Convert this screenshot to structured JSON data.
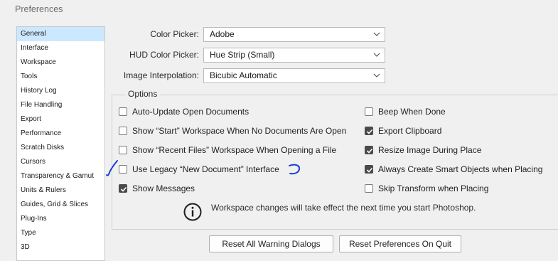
{
  "window": {
    "title": "Preferences"
  },
  "sidebar": {
    "items": [
      {
        "label": "General",
        "selected": true
      },
      {
        "label": "Interface"
      },
      {
        "label": "Workspace"
      },
      {
        "label": "Tools"
      },
      {
        "label": "History Log"
      },
      {
        "label": "File Handling"
      },
      {
        "label": "Export"
      },
      {
        "label": "Performance"
      },
      {
        "label": "Scratch Disks"
      },
      {
        "label": "Cursors"
      },
      {
        "label": "Transparency & Gamut"
      },
      {
        "label": "Units & Rulers"
      },
      {
        "label": "Guides, Grid & Slices"
      },
      {
        "label": "Plug-Ins"
      },
      {
        "label": "Type"
      },
      {
        "label": "3D"
      }
    ]
  },
  "fields": {
    "color_picker": {
      "label": "Color Picker:",
      "value": "Adobe"
    },
    "hud_color_picker": {
      "label": "HUD Color Picker:",
      "value": "Hue Strip (Small)"
    },
    "image_interpolation": {
      "label": "Image Interpolation:",
      "value": "Bicubic Automatic"
    }
  },
  "options": {
    "legend": "Options",
    "left": [
      {
        "label": "Auto-Update Open Documents",
        "checked": false
      },
      {
        "label": "Show “Start” Workspace When No Documents Are Open",
        "checked": false
      },
      {
        "label": "Show “Recent Files” Workspace When Opening a File",
        "checked": false
      },
      {
        "label": "Use Legacy “New Document” Interface",
        "checked": false
      },
      {
        "label": "Show Messages",
        "checked": true
      }
    ],
    "right": [
      {
        "label": "Beep When Done",
        "checked": false
      },
      {
        "label": "Export Clipboard",
        "checked": true
      },
      {
        "label": "Resize Image During Place",
        "checked": true
      },
      {
        "label": "Always Create Smart Objects when Placing",
        "checked": true
      },
      {
        "label": "Skip Transform when Placing",
        "checked": false
      }
    ]
  },
  "info": {
    "icon": "info-circle-icon",
    "text": "Workspace changes will take effect the next time you start Photoshop."
  },
  "buttons": {
    "reset_warnings": "Reset All Warning Dialogs",
    "reset_prefs": "Reset Preferences On Quit"
  },
  "colors": {
    "selected_bg": "#cce8ff",
    "annotation": "#1a3fd6"
  }
}
